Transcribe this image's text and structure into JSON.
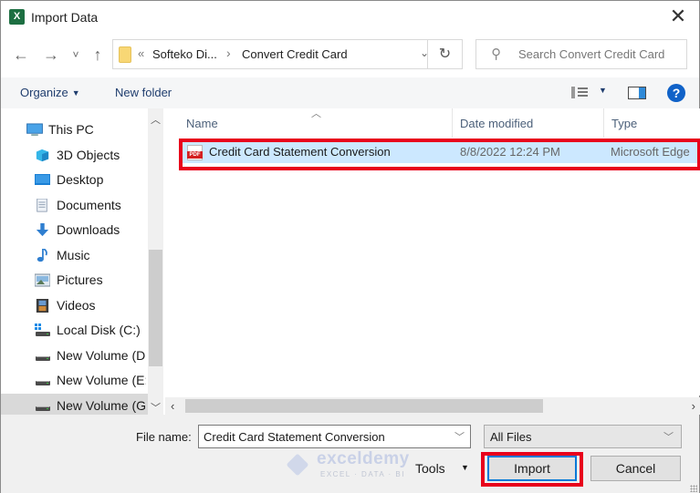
{
  "window": {
    "title": "Import Data",
    "app_icon": "excel-icon",
    "close_label": "✕"
  },
  "nav": {
    "back_label": "←",
    "forward_label": "→",
    "recent_label": "˅",
    "up_label": "↑"
  },
  "address": {
    "overflow": "«",
    "segments": [
      "Softeko Di...",
      "Convert Credit Card"
    ],
    "separator": "›",
    "dropdown": "⌄",
    "refresh": "↻"
  },
  "search": {
    "placeholder": "Search Convert Credit Card",
    "icon": "⚲"
  },
  "toolbar": {
    "organize_label": "Organize",
    "new_folder_label": "New folder",
    "help_label": "?"
  },
  "navpane": {
    "items": [
      {
        "label": "This PC",
        "icon": "computer-icon"
      },
      {
        "label": "3D Objects",
        "icon": "3d-objects-icon"
      },
      {
        "label": "Desktop",
        "icon": "desktop-icon"
      },
      {
        "label": "Documents",
        "icon": "documents-icon"
      },
      {
        "label": "Downloads",
        "icon": "downloads-icon"
      },
      {
        "label": "Music",
        "icon": "music-icon"
      },
      {
        "label": "Pictures",
        "icon": "pictures-icon"
      },
      {
        "label": "Videos",
        "icon": "videos-icon"
      },
      {
        "label": "Local Disk (C:)",
        "icon": "local-disk-icon"
      },
      {
        "label": "New Volume (D:)",
        "icon": "drive-icon"
      },
      {
        "label": "New Volume (E:)",
        "icon": "drive-icon"
      },
      {
        "label": "New Volume (G:)",
        "icon": "drive-icon",
        "selected": true
      }
    ]
  },
  "filelist": {
    "columns": [
      "Name",
      "Date modified",
      "Type"
    ],
    "rows": [
      {
        "name": "Credit Card Statement Conversion",
        "date_modified": "8/8/2022 12:24 PM",
        "type": "Microsoft Edge",
        "icon": "pdf-icon",
        "selected": true
      }
    ]
  },
  "bottom": {
    "file_name_label": "File name:",
    "file_name_value": "Credit Card Statement Conversion",
    "file_type_value": "All Files",
    "tools_label": "Tools",
    "import_label": "Import",
    "cancel_label": "Cancel"
  },
  "watermark": {
    "brand": "exceldemy",
    "tagline": "EXCEL · DATA · BI"
  },
  "colors": {
    "highlight": "#e8001c",
    "selection": "#cce8ff",
    "accent": "#0078d7",
    "link": "#1f3d6e"
  }
}
